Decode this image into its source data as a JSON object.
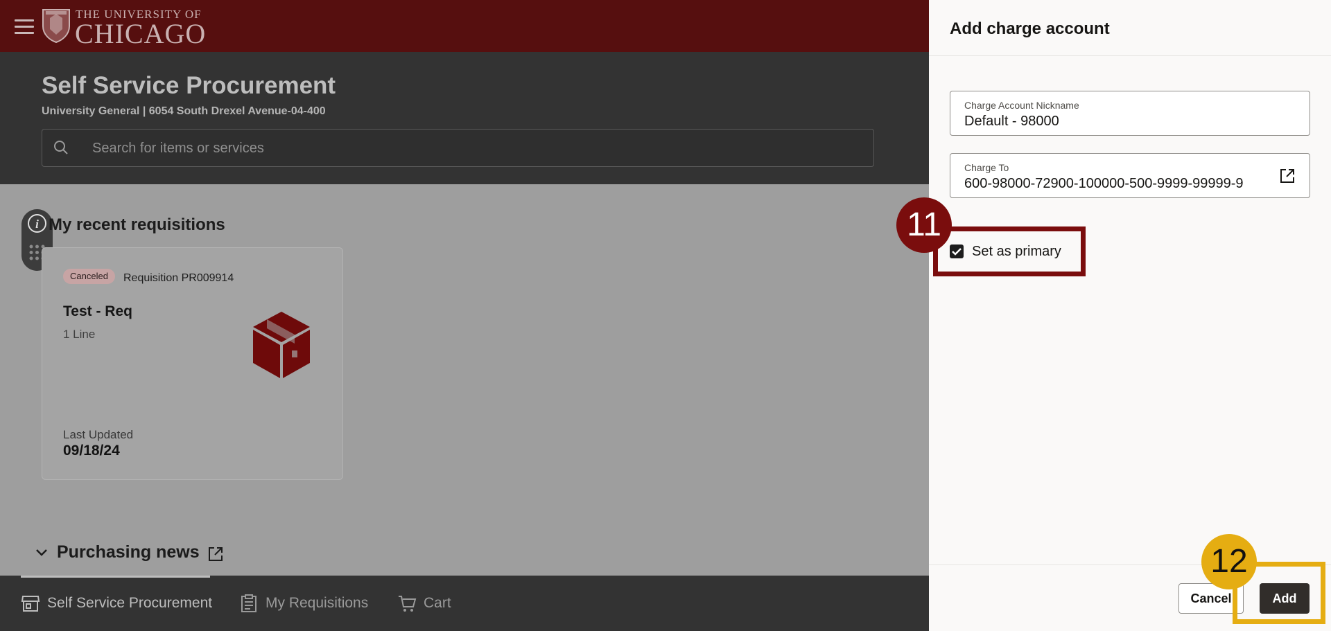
{
  "brand": {
    "line1": "THE UNIVERSITY OF",
    "line2": "CHICAGO"
  },
  "header": {
    "title": "Self Service Procurement",
    "subtitle": "University General | 6054 South Drexel Avenue-04-400",
    "search_placeholder": "Search for items or services"
  },
  "recent": {
    "section_title": "My recent requisitions",
    "card": {
      "status": "Canceled",
      "requisition": "Requisition PR009914",
      "title": "Test - Req",
      "lines": "1 Line",
      "updated_label": "Last Updated",
      "updated_value": "09/18/24"
    }
  },
  "news": {
    "title": "Purchasing news"
  },
  "bottom_nav": {
    "items": [
      {
        "label": "Self Service Procurement",
        "icon": "store-icon",
        "active": true
      },
      {
        "label": "My Requisitions",
        "icon": "clipboard-icon",
        "active": false
      },
      {
        "label": "Cart",
        "icon": "cart-icon",
        "active": false
      }
    ]
  },
  "panel": {
    "title": "Add charge account",
    "nickname_label": "Charge Account Nickname",
    "nickname_value": "Default - 98000",
    "charge_to_label": "Charge To",
    "charge_to_value": "600-98000-72900-100000-500-9999-99999-9",
    "primary_label": "Set as primary",
    "primary_checked": true,
    "cancel_label": "Cancel",
    "add_label": "Add"
  },
  "callouts": {
    "step_11": "11",
    "step_12": "12"
  },
  "colors": {
    "brand_maroon": "#560f0f",
    "callout_maroon": "#7a0d0d",
    "callout_gold": "#e5ad12",
    "header_dark": "#333333",
    "panel_bg": "#faf9f8",
    "add_button": "#312d2a"
  }
}
